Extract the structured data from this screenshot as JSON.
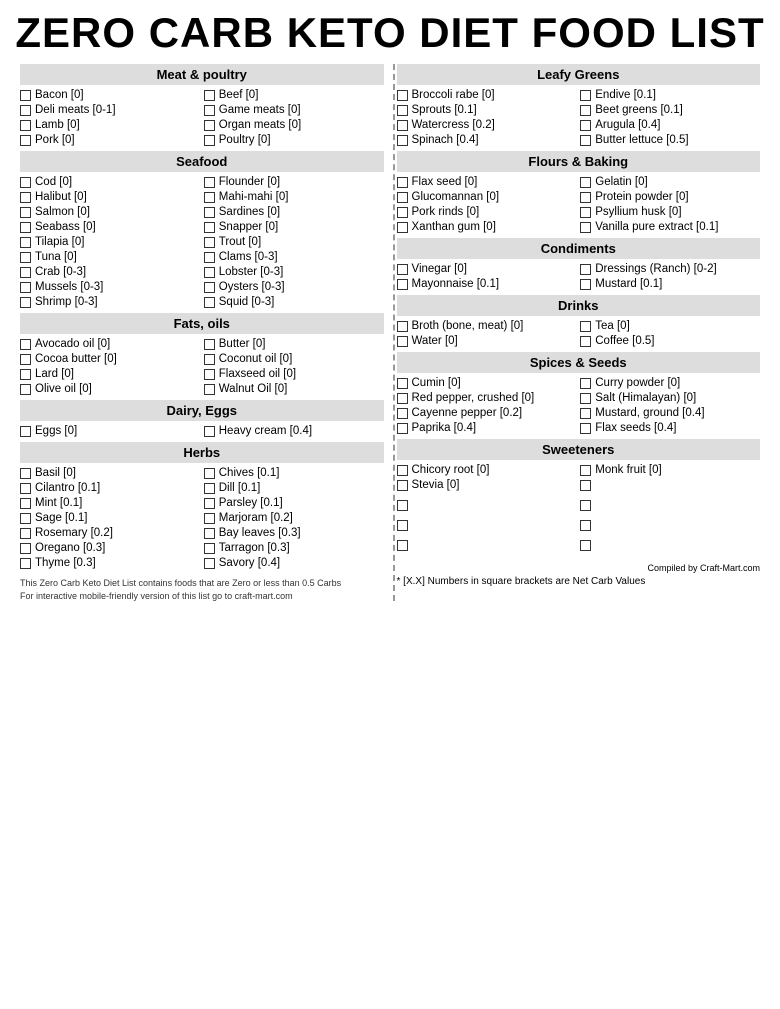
{
  "title": "ZERO CARB KETO DIET FOOD LIST",
  "left_column": {
    "sections": [
      {
        "id": "meat-poultry",
        "header": "Meat & poultry",
        "items": [
          "Bacon [0]",
          "Beef [0]",
          "Deli meats [0-1]",
          "Game meats [0]",
          "Lamb [0]",
          "Organ meats [0]",
          "Pork [0]",
          "Poultry [0]"
        ]
      },
      {
        "id": "seafood",
        "header": "Seafood",
        "items": [
          "Cod [0]",
          "Flounder [0]",
          "Halibut [0]",
          "Mahi-mahi [0]",
          "Salmon [0]",
          "Sardines [0]",
          "Seabass [0]",
          "Snapper [0]",
          "Tilapia [0]",
          "Trout [0]",
          "Tuna [0]",
          "Clams [0-3]",
          "Crab [0-3]",
          "Lobster [0-3]",
          "Mussels [0-3]",
          "Oysters [0-3]",
          "Shrimp [0-3]",
          "Squid [0-3]"
        ]
      },
      {
        "id": "fats-oils",
        "header": "Fats, oils",
        "items": [
          "Avocado oil [0]",
          "Butter [0]",
          "Cocoa butter [0]",
          "Coconut oil [0]",
          "Lard [0]",
          "Flaxseed oil [0]",
          "Olive oil [0]",
          "Walnut Oil [0]"
        ]
      },
      {
        "id": "dairy-eggs",
        "header": "Dairy, Eggs",
        "items": [
          "Eggs [0]",
          "Heavy cream [0.4]"
        ]
      },
      {
        "id": "herbs",
        "header": "Herbs",
        "items": [
          "Basil [0]",
          "Chives [0.1]",
          "Cilantro [0.1]",
          "Dill [0.1]",
          "Mint [0.1]",
          "Parsley [0.1]",
          "Sage [0.1]",
          "Marjoram [0.2]",
          "Rosemary [0.2]",
          "Bay leaves [0.3]",
          "Oregano [0.3]",
          "Tarragon [0.3]",
          "Thyme [0.3]",
          "Savory [0.4]"
        ]
      }
    ],
    "footer": {
      "line1": "This Zero Carb Keto Diet List contains foods that are Zero or less than 0.5 Carbs",
      "line2": "For interactive mobile-friendly version of this list go to craft-mart.com"
    }
  },
  "right_column": {
    "sections": [
      {
        "id": "leafy-greens",
        "header": "Leafy Greens",
        "items": [
          "Broccoli rabe [0]",
          "Endive [0.1]",
          "Sprouts [0.1]",
          "Beet greens [0.1]",
          "Watercress [0.2]",
          "Arugula [0.4]",
          "Spinach [0.4]",
          "Butter lettuce [0.5]"
        ]
      },
      {
        "id": "flours-baking",
        "header": "Flours & Baking",
        "items": [
          "Flax seed [0]",
          "Gelatin [0]",
          "Glucomannan [0]",
          "Protein powder [0]",
          "Pork rinds [0]",
          "Psyllium husk [0]",
          "Xanthan gum [0]",
          "Vanilla pure extract [0.1]"
        ]
      },
      {
        "id": "condiments",
        "header": "Condiments",
        "items": [
          "Vinegar [0]",
          "Dressings (Ranch) [0-2]",
          "Mayonnaise [0.1]",
          "Mustard [0.1]"
        ]
      },
      {
        "id": "drinks",
        "header": "Drinks",
        "items": [
          "Broth (bone, meat) [0]",
          "Tea [0]",
          "Water [0]",
          "Coffee [0.5]"
        ]
      },
      {
        "id": "spices-seeds",
        "header": "Spices & Seeds",
        "items": [
          "Cumin [0]",
          "Curry powder [0]",
          "Red pepper, crushed [0]",
          "Salt (Himalayan) [0]",
          "Cayenne pepper [0.2]",
          "Mustard, ground [0.4]",
          "Paprika [0.4]",
          "Flax seeds [0.4]"
        ]
      },
      {
        "id": "sweeteners",
        "header": "Sweeteners",
        "items": [
          "Chicory root [0]",
          "Monk fruit [0]",
          "Stevia [0]",
          ""
        ]
      }
    ],
    "footer": {
      "compiled": "Compiled by Craft-Mart.com",
      "note": "* [X.X] Numbers in square brackets are Net Carb Values"
    }
  }
}
